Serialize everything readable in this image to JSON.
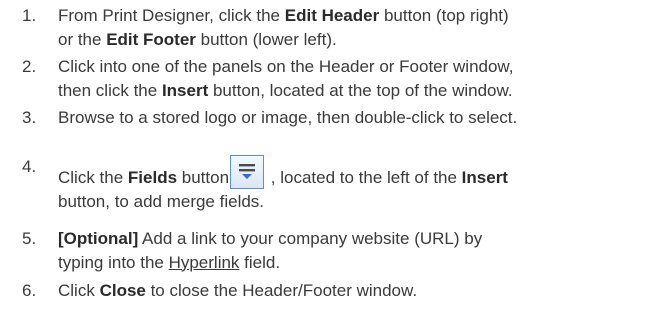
{
  "steps": [
    {
      "num": "1.",
      "l1a": "From Print Designer, click the ",
      "l1b": "Edit Header",
      "l1c": " button (top right)",
      "l2a": "or the ",
      "l2b": "Edit Footer",
      "l2c": " button (lower left)."
    },
    {
      "num": "2.",
      "l1": "Click into one of the panels on the Header or Footer window,",
      "l2a": "then click the ",
      "l2b": "Insert",
      "l2c": " button, located at the top of the window."
    },
    {
      "num": "3.",
      "l1": "Browse to a stored logo or image, then double-click to select."
    },
    {
      "num": "4.",
      "l1a": "Click the ",
      "l1b": "Fields",
      "l1c": " button",
      "l1d": " , located to the left of the ",
      "l1e": "Insert",
      "l2": "button, to add merge fields.",
      "icon": "fields-icon"
    },
    {
      "num": "5.",
      "l1a": "[Optional]",
      "l1b": " Add a link to your company website (URL) by",
      "l2a": "typing into the ",
      "l2b": "Hyperlink",
      "l2c": " field."
    },
    {
      "num": "6.",
      "l1a": "Click ",
      "l1b": "Close",
      "l1c": " to close the Header/Footer window."
    }
  ]
}
